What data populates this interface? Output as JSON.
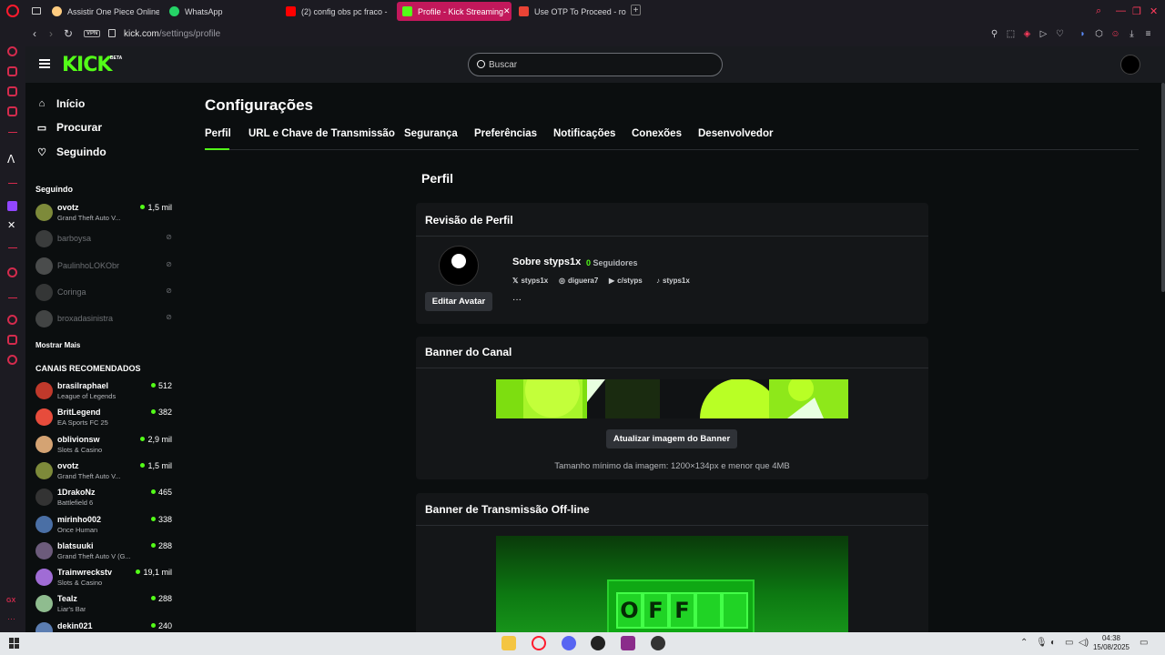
{
  "browser": {
    "tabs": [
      {
        "label": "Assistir One Piece Online",
        "color": "#ffcc80"
      },
      {
        "label": "WhatsApp",
        "color": "#25d366"
      },
      {
        "label": "(2) config obs pc fraco -",
        "color": "#ff0000"
      },
      {
        "label": "Profile - Kick Streaming",
        "color": "#53fc18"
      },
      {
        "label": "Use OTP To Proceed - ro",
        "color": "#ea4335"
      }
    ],
    "new_tab": "+",
    "url_host": "kick.com",
    "url_path": "/settings/profile",
    "vpn_badge": "VPN"
  },
  "kick": {
    "logo": "KICK",
    "beta": "BETA",
    "search_placeholder": "Buscar",
    "nav": [
      {
        "label": "Início",
        "icon": "home-icon"
      },
      {
        "label": "Procurar",
        "icon": "browse-icon"
      },
      {
        "label": "Seguindo",
        "icon": "heart-icon"
      }
    ],
    "following_title": "Seguindo",
    "following": [
      {
        "name": "ovotz",
        "game": "Grand Theft Auto V...",
        "viewers": "1,5 mil",
        "live": true,
        "color": "#7d8a3a"
      },
      {
        "name": "barboysa",
        "game": "",
        "viewers": "",
        "live": false,
        "color": "#6a6a6a"
      },
      {
        "name": "PaulinhoLOKObr",
        "game": "",
        "viewers": "",
        "live": false,
        "color": "#8a8a8a"
      },
      {
        "name": "Coringa",
        "game": "",
        "viewers": "",
        "live": false,
        "color": "#5d5d5d"
      },
      {
        "name": "broxadasinistra",
        "game": "",
        "viewers": "",
        "live": false,
        "color": "#7a7a7a"
      }
    ],
    "show_more": "Mostrar Mais",
    "recommended_title": "CANAIS RECOMENDADOS",
    "recommended": [
      {
        "name": "brasilraphael",
        "game": "League of Legends",
        "viewers": "512",
        "color": "#c0392b"
      },
      {
        "name": "BritLegend",
        "game": "EA Sports FC 25",
        "viewers": "382",
        "color": "#e74c3c"
      },
      {
        "name": "oblivionsw",
        "game": "Slots & Casino",
        "viewers": "2,9 mil",
        "color": "#d4a373"
      },
      {
        "name": "ovotz",
        "game": "Grand Theft Auto V...",
        "viewers": "1,5 mil",
        "color": "#7d8a3a"
      },
      {
        "name": "1DrakoNz",
        "game": "Battlefield 6",
        "viewers": "465",
        "color": "#333333"
      },
      {
        "name": "mirinho002",
        "game": "Once Human",
        "viewers": "338",
        "color": "#4a6fa5"
      },
      {
        "name": "blatsuuki",
        "game": "Grand Theft Auto V (G...",
        "viewers": "288",
        "color": "#6c5b7b"
      },
      {
        "name": "Trainwreckstv",
        "game": "Slots & Casino",
        "viewers": "19,1 mil",
        "color": "#a06cd5"
      },
      {
        "name": "Tealz",
        "game": "Liar's Bar",
        "viewers": "288",
        "color": "#8fbc8f"
      },
      {
        "name": "dekin021",
        "game": "",
        "viewers": "240",
        "color": "#5b7db1"
      }
    ],
    "page_title": "Configurações",
    "tabs": [
      "Perfil",
      "URL e Chave de Transmissão",
      "Segurança",
      "Preferências",
      "Notificações",
      "Conexões",
      "Desenvolvedor"
    ],
    "section_title": "Perfil",
    "profile_card": {
      "title": "Revisão de Perfil",
      "about": "Sobre styps1x",
      "followers_count": "0",
      "followers_label": "Seguidores",
      "edit_avatar": "Editar Avatar",
      "more": "···",
      "socials": [
        {
          "icon": "x-icon",
          "glyph": "𝕏",
          "label": "styps1x"
        },
        {
          "icon": "instagram-icon",
          "glyph": "◎",
          "label": "diguera7"
        },
        {
          "icon": "youtube-icon",
          "glyph": "▶",
          "label": "c/styps"
        },
        {
          "icon": "tiktok-icon",
          "glyph": "♪",
          "label": "styps1x"
        }
      ]
    },
    "banner_card": {
      "title": "Banner do Canal",
      "button": "Atualizar imagem do Banner",
      "hint": "Tamanho mínimo da imagem: 1200×134px e menor que 4MB"
    },
    "offline_card": {
      "title": "Banner de Transmissão Off-line",
      "letters": [
        "O",
        "F",
        "F",
        "",
        ""
      ]
    }
  },
  "taskbar": {
    "time": "04:38",
    "date": "15/08/2025"
  }
}
